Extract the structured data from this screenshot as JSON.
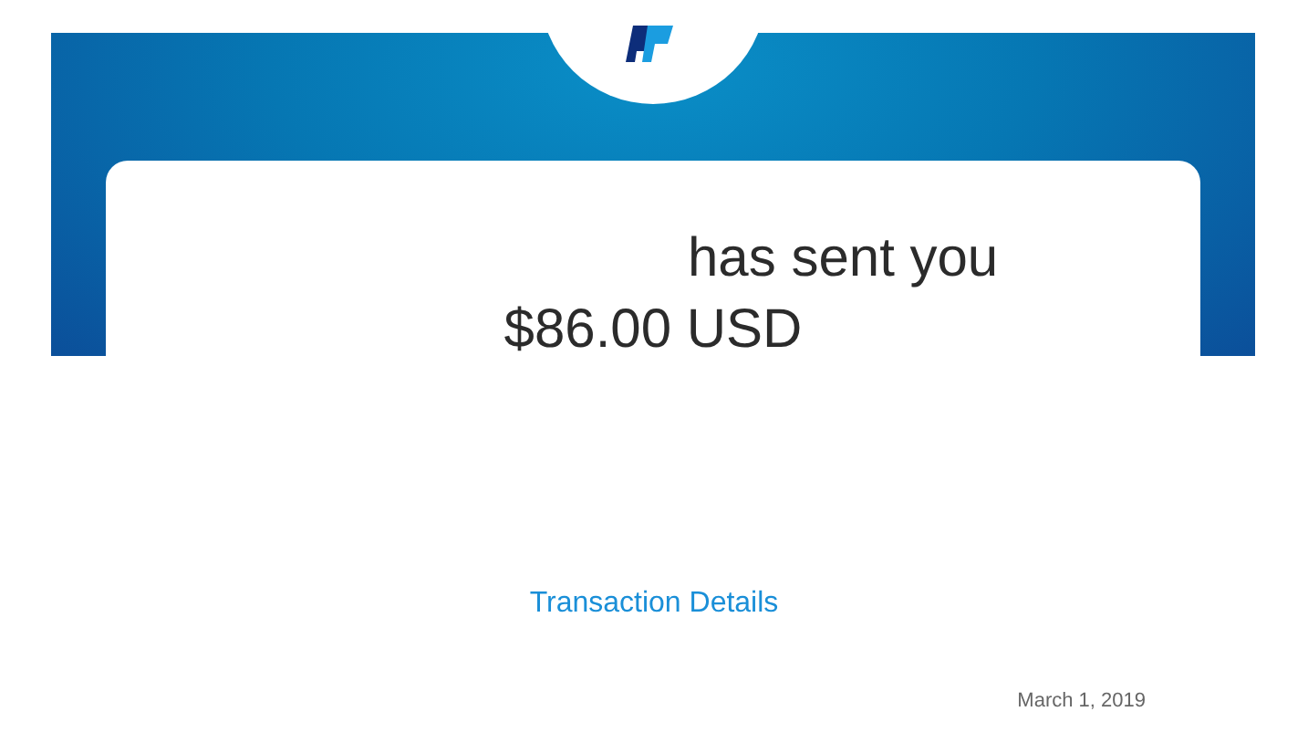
{
  "message": {
    "headline": "has sent you",
    "amount": "$86.00 USD"
  },
  "link": "Transaction Details",
  "date": "March 1, 2019"
}
